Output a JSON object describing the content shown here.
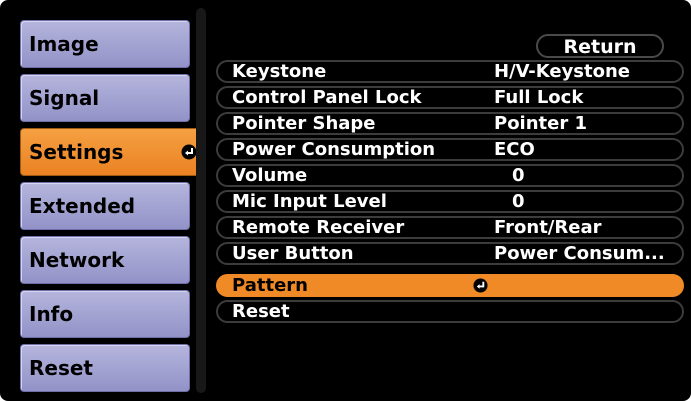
{
  "sidebar": {
    "items": [
      {
        "label": "Image"
      },
      {
        "label": "Signal"
      },
      {
        "label": "Settings"
      },
      {
        "label": "Extended"
      },
      {
        "label": "Network"
      },
      {
        "label": "Info"
      },
      {
        "label": "Reset"
      }
    ],
    "active_index": 2
  },
  "settings": {
    "return_label": "Return",
    "rows": [
      {
        "label": "Keystone",
        "value": "H/V-Keystone"
      },
      {
        "label": "Control Panel Lock",
        "value": "Full Lock"
      },
      {
        "label": "Pointer Shape",
        "value": "Pointer 1"
      },
      {
        "label": "Power Consumption",
        "value": "ECO"
      },
      {
        "label": "Volume",
        "value": "0"
      },
      {
        "label": "Mic Input Level",
        "value": "0"
      },
      {
        "label": "Remote Receiver",
        "value": "Front/Rear"
      },
      {
        "label": "User Button",
        "value": "Power Consum..."
      },
      {
        "label": "Pattern",
        "value": ""
      },
      {
        "label": "Reset",
        "value": ""
      }
    ],
    "selected_index": 8
  },
  "colors": {
    "accent": "#f08a26",
    "menu_bg": "#a3a3d3",
    "panel_bg": "#000000"
  }
}
